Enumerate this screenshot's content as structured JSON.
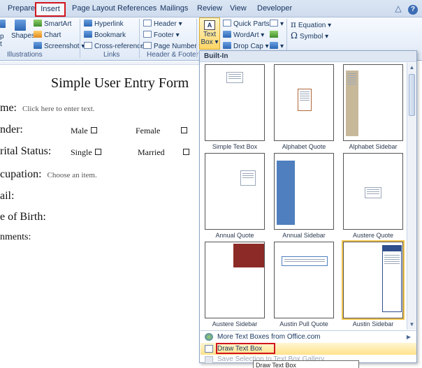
{
  "tabs": {
    "prepare": "Prepare",
    "insert": "Insert",
    "page_layout": "Page Layout",
    "references": "References",
    "mailings": "Mailings",
    "review": "Review",
    "view": "View",
    "developer": "Developer",
    "help_glyph": "?",
    "minimize_glyph": "△"
  },
  "ribbon": {
    "illustrations": {
      "label": "Illustrations",
      "shapes": "Shapes",
      "smartart": "SmartArt",
      "chart": "Chart",
      "screenshot": "Screenshot ▾"
    },
    "links": {
      "label": "Links",
      "hyperlink": "Hyperlink",
      "bookmark": "Bookmark",
      "cross_reference": "Cross-reference"
    },
    "header_footer": {
      "label": "Header & Footer",
      "header": "Header ▾",
      "footer": "Footer ▾",
      "page_number": "Page Number ▾"
    },
    "text": {
      "text_box": "Text Box ▾",
      "text_box_glyph": "A",
      "quick_parts": "Quick Parts ▾",
      "wordart": "WordArt ▾",
      "drop_cap": "Drop Cap ▾"
    },
    "symbols": {
      "equation": "Equation ▾",
      "symbol": "Symbol ▾"
    }
  },
  "document": {
    "title": "Simple User Entry Form",
    "name_label": "me:",
    "name_hint": "Click here to enter text.",
    "gender_label": "nder:",
    "male": "Male",
    "female": "Female",
    "marital_label": "rital Status:",
    "single": "Single",
    "married": "Married",
    "occupation_label": "cupation:",
    "occupation_hint": "Choose an item.",
    "email_label": "ail:",
    "dob_label": "e of Birth:",
    "comments_label": "nments:"
  },
  "gallery": {
    "header": "Built-In",
    "items": [
      {
        "label": "Simple Text Box"
      },
      {
        "label": "Alphabet Quote"
      },
      {
        "label": "Alphabet Sidebar"
      },
      {
        "label": "Annual Quote"
      },
      {
        "label": "Annual Sidebar"
      },
      {
        "label": "Austere Quote"
      },
      {
        "label": "Austere Sidebar"
      },
      {
        "label": "Austin Pull Quote"
      },
      {
        "label": "Austin Sidebar"
      }
    ],
    "more": "More Text Boxes from Office.com",
    "draw": "Draw Text Box",
    "save": "Save Selection to Text Box Gallery",
    "tooltip": "Draw Text Box"
  },
  "colors": {
    "highlight_red": "#d2161e",
    "ribbon_blue": "#dfe9f6",
    "annual_sidebar": "#4f7fbf",
    "austere_sidebar": "#8b2a26",
    "alphabet_sidebar": "#c8b89a"
  }
}
